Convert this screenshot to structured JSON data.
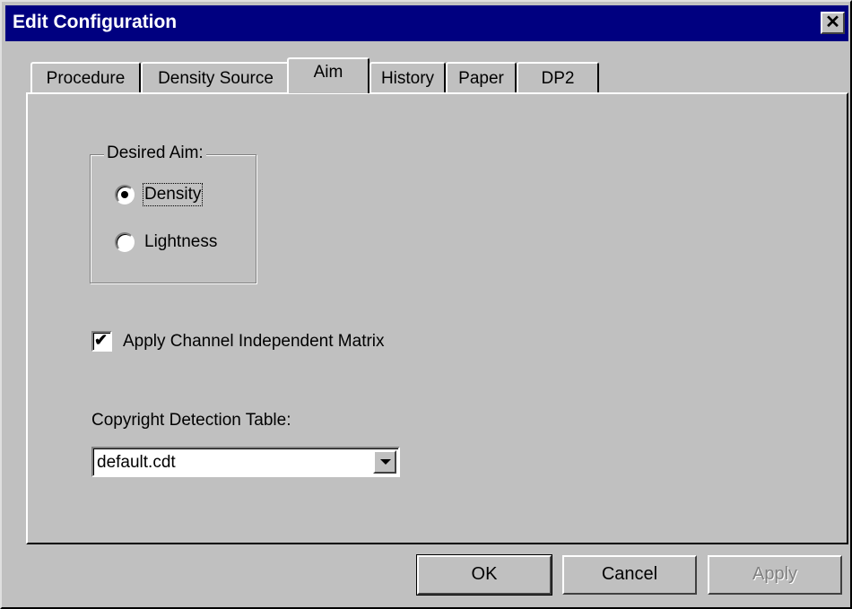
{
  "window": {
    "title": "Edit Configuration",
    "close_label": "✕"
  },
  "tabs": [
    {
      "label": "Procedure",
      "active": false
    },
    {
      "label": "Density Source",
      "active": false
    },
    {
      "label": "Aim",
      "active": true
    },
    {
      "label": "History",
      "active": false
    },
    {
      "label": "Paper",
      "active": false
    },
    {
      "label": "DP2",
      "active": false
    }
  ],
  "aim_group": {
    "legend": "Desired Aim:",
    "options": [
      {
        "label": "Density",
        "selected": true
      },
      {
        "label": "Lightness",
        "selected": false
      }
    ]
  },
  "matrix_checkbox": {
    "label": "Apply Channel Independent Matrix",
    "checked": true
  },
  "copyright": {
    "label": "Copyright Detection Table:",
    "value": "default.cdt"
  },
  "buttons": {
    "ok": "OK",
    "cancel": "Cancel",
    "apply": "Apply"
  }
}
